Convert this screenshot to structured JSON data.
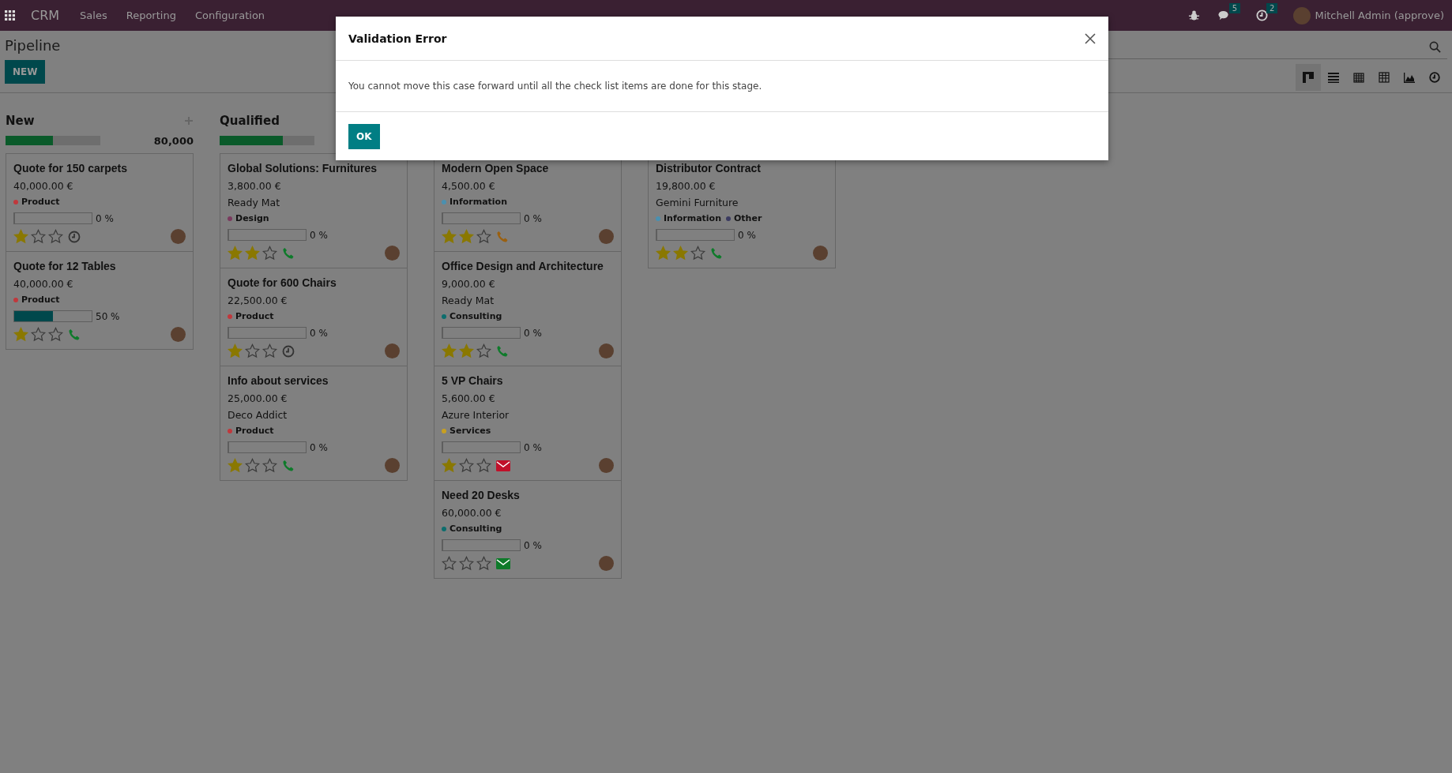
{
  "navbar": {
    "app": "CRM",
    "menu": [
      "Sales",
      "Reporting",
      "Configuration"
    ],
    "messages_badge": "5",
    "activities_badge": "2",
    "user": "Mitchell Admin (approve)"
  },
  "control_panel": {
    "title": "Pipeline",
    "new_button": "NEW",
    "views": [
      {
        "kind": "kanban",
        "selected": true
      },
      {
        "kind": "list",
        "selected": false
      },
      {
        "kind": "calendar",
        "selected": false
      },
      {
        "kind": "pivot",
        "selected": false
      },
      {
        "kind": "graph",
        "selected": false
      },
      {
        "kind": "activity",
        "selected": false
      }
    ]
  },
  "columns": [
    {
      "title": "New",
      "total": "80,000",
      "level": 0.5,
      "cards": [
        {
          "title": "Quote for 150 carpets",
          "amount": "40,000.00 €",
          "tags": [
            {
              "label": "Product",
              "color": "#c0383c"
            }
          ],
          "level": 0,
          "reading": "0 %",
          "stars": 1,
          "activity": {
            "kind": "clock",
            "color": "#333333"
          }
        },
        {
          "title": "Quote for 12 Tables",
          "amount": "40,000.00 €",
          "tags": [
            {
              "label": "Product",
              "color": "#c0383c"
            }
          ],
          "level": 0.5,
          "reading": "50 %",
          "stars": 1,
          "activity": {
            "kind": "phone",
            "color": "#0e7a2a"
          }
        }
      ]
    },
    {
      "title": "Qualified",
      "level": 0.67,
      "cards": [
        {
          "title": "Global Solutions: Furnitures",
          "amount": "3,800.00 €",
          "company": "Ready Mat",
          "tags": [
            {
              "label": "Design",
              "color": "#7a3a5e"
            }
          ],
          "level": 0,
          "reading": "0 %",
          "stars": 2,
          "activity": {
            "kind": "phone",
            "color": "#0e7a2a"
          }
        },
        {
          "title": "Quote for 600 Chairs",
          "amount": "22,500.00 €",
          "tags": [
            {
              "label": "Product",
              "color": "#c0383c"
            }
          ],
          "level": 0,
          "reading": "0 %",
          "stars": 1,
          "activity": {
            "kind": "clock",
            "color": "#333333"
          }
        },
        {
          "title": "Info about services",
          "amount": "25,000.00 €",
          "company": "Deco Addict",
          "tags": [
            {
              "label": "Product",
              "color": "#c0383c"
            }
          ],
          "level": 0,
          "reading": "0 %",
          "stars": 1,
          "activity": {
            "kind": "phone",
            "color": "#0e7a2a"
          }
        }
      ]
    },
    {
      "cards": [
        {
          "title": "Modern Open Space",
          "amount": "4,500.00 €",
          "tags": [
            {
              "label": "Information",
              "color": "#4a90b0"
            }
          ],
          "level": 0,
          "reading": "0 %",
          "stars": 2,
          "activity": {
            "kind": "phone",
            "color": "#9a6010"
          }
        },
        {
          "title": "Office Design and Architecture",
          "amount": "9,000.00 €",
          "company": "Ready Mat",
          "tags": [
            {
              "label": "Consulting",
              "color": "#0d6d6d"
            }
          ],
          "level": 0,
          "reading": "0 %",
          "stars": 2,
          "activity": {
            "kind": "phone",
            "color": "#0e7a2a"
          }
        },
        {
          "title": "5 VP Chairs",
          "amount": "5,600.00 €",
          "company": "Azure Interior",
          "tags": [
            {
              "label": "Services",
              "color": "#c8a020"
            }
          ],
          "level": 0,
          "reading": "0 %",
          "stars": 1,
          "activity": {
            "kind": "email",
            "color": "#c0102a"
          }
        },
        {
          "title": "Need 20 Desks",
          "amount": "60,000.00 €",
          "tags": [
            {
              "label": "Consulting",
              "color": "#0d6d6d"
            }
          ],
          "level": 0,
          "reading": "0 %",
          "stars": 0,
          "activity": {
            "kind": "email",
            "color": "#0e7a2a"
          }
        }
      ]
    },
    {
      "cards": [
        {
          "title": "Distributor Contract",
          "amount": "19,800.00 €",
          "company": "Gemini Furniture",
          "tags": [
            {
              "label": "Information",
              "color": "#4a90b0"
            },
            {
              "label": "Other",
              "color": "#3a3a60"
            }
          ],
          "level": 0,
          "reading": "0 %",
          "stars": 2,
          "activity": {
            "kind": "phone",
            "color": "#0e7a2a"
          }
        }
      ]
    }
  ],
  "dialog": {
    "title": "Validation Error",
    "message": "You cannot move this case forward until all the check list items are done for this stage.",
    "button": "OK"
  }
}
